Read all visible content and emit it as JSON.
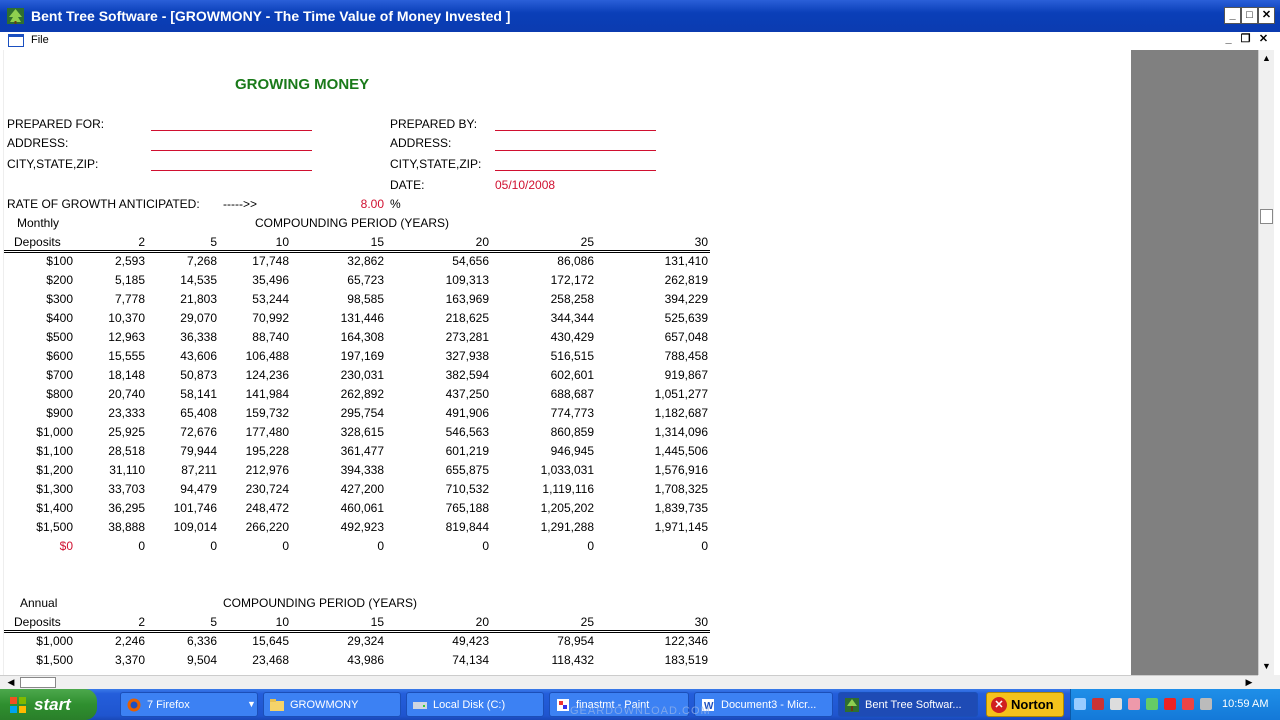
{
  "window": {
    "title": "Bent Tree Software - [GROWMONY - The Time Value of Money Invested ]",
    "min_glyph": "_",
    "max_glyph": "□",
    "close_glyph": "✕"
  },
  "menu": {
    "file": "File",
    "mdi_min": "_",
    "mdi_restore": "❐",
    "mdi_close": "✕"
  },
  "sheet": {
    "heading": "GROWING MONEY",
    "prepared_for": "PREPARED FOR:",
    "address_left": "ADDRESS:",
    "csz_left": "CITY,STATE,ZIP:",
    "prepared_by": "PREPARED BY:",
    "address_right": "ADDRESS:",
    "csz_right": "CITY,STATE,ZIP:",
    "date_label": "DATE:",
    "date_value": "05/10/2008",
    "rate_label": "RATE OF GROWTH ANTICIPATED:",
    "rate_arrow": "----->>",
    "rate_value": "8.00",
    "rate_unit": "%",
    "monthly": {
      "title1": "Monthly",
      "title2": "Deposits",
      "period_header": "COMPOUNDING PERIOD (YEARS)",
      "years": [
        "2",
        "5",
        "10",
        "15",
        "20",
        "25",
        "30"
      ],
      "rows": [
        [
          "$100",
          "2,593",
          "7,268",
          "17,748",
          "32,862",
          "54,656",
          "86,086",
          "131,410"
        ],
        [
          "$200",
          "5,185",
          "14,535",
          "35,496",
          "65,723",
          "109,313",
          "172,172",
          "262,819"
        ],
        [
          "$300",
          "7,778",
          "21,803",
          "53,244",
          "98,585",
          "163,969",
          "258,258",
          "394,229"
        ],
        [
          "$400",
          "10,370",
          "29,070",
          "70,992",
          "131,446",
          "218,625",
          "344,344",
          "525,639"
        ],
        [
          "$500",
          "12,963",
          "36,338",
          "88,740",
          "164,308",
          "273,281",
          "430,429",
          "657,048"
        ],
        [
          "$600",
          "15,555",
          "43,606",
          "106,488",
          "197,169",
          "327,938",
          "516,515",
          "788,458"
        ],
        [
          "$700",
          "18,148",
          "50,873",
          "124,236",
          "230,031",
          "382,594",
          "602,601",
          "919,867"
        ],
        [
          "$800",
          "20,740",
          "58,141",
          "141,984",
          "262,892",
          "437,250",
          "688,687",
          "1,051,277"
        ],
        [
          "$900",
          "23,333",
          "65,408",
          "159,732",
          "295,754",
          "491,906",
          "774,773",
          "1,182,687"
        ],
        [
          "$1,000",
          "25,925",
          "72,676",
          "177,480",
          "328,615",
          "546,563",
          "860,859",
          "1,314,096"
        ],
        [
          "$1,100",
          "28,518",
          "79,944",
          "195,228",
          "361,477",
          "601,219",
          "946,945",
          "1,445,506"
        ],
        [
          "$1,200",
          "31,110",
          "87,211",
          "212,976",
          "394,338",
          "655,875",
          "1,033,031",
          "1,576,916"
        ],
        [
          "$1,300",
          "33,703",
          "94,479",
          "230,724",
          "427,200",
          "710,532",
          "1,119,116",
          "1,708,325"
        ],
        [
          "$1,400",
          "36,295",
          "101,746",
          "248,472",
          "460,061",
          "765,188",
          "1,205,202",
          "1,839,735"
        ],
        [
          "$1,500",
          "38,888",
          "109,014",
          "266,220",
          "492,923",
          "819,844",
          "1,291,288",
          "1,971,145"
        ],
        [
          "$0",
          "0",
          "0",
          "0",
          "0",
          "0",
          "0",
          "0"
        ]
      ]
    },
    "annual": {
      "title1": "Annual",
      "title2": "Deposits",
      "period_header": "COMPOUNDING PERIOD (YEARS)",
      "years": [
        "2",
        "5",
        "10",
        "15",
        "20",
        "25",
        "30"
      ],
      "rows": [
        [
          "$1,000",
          "2,246",
          "6,336",
          "15,645",
          "29,324",
          "49,423",
          "78,954",
          "122,346"
        ],
        [
          "$1,500",
          "3,370",
          "9,504",
          "23,468",
          "43,986",
          "74,134",
          "118,432",
          "183,519"
        ]
      ]
    }
  },
  "taskbar": {
    "start": "start",
    "items": [
      {
        "label": "7 Firefox",
        "icon": "firefox-icon"
      },
      {
        "label": "GROWMONY",
        "icon": "folder-icon"
      },
      {
        "label": "Local Disk (C:)",
        "icon": "drive-icon"
      },
      {
        "label": "finastmt - Paint",
        "icon": "paint-icon"
      },
      {
        "label": "Document3 - Micr...",
        "icon": "word-icon"
      },
      {
        "label": "Bent Tree Softwar...",
        "icon": "app-icon"
      }
    ],
    "norton": "Norton",
    "clock": "10:59 AM",
    "watermark": "GEARDOWNLOAD.COM"
  }
}
